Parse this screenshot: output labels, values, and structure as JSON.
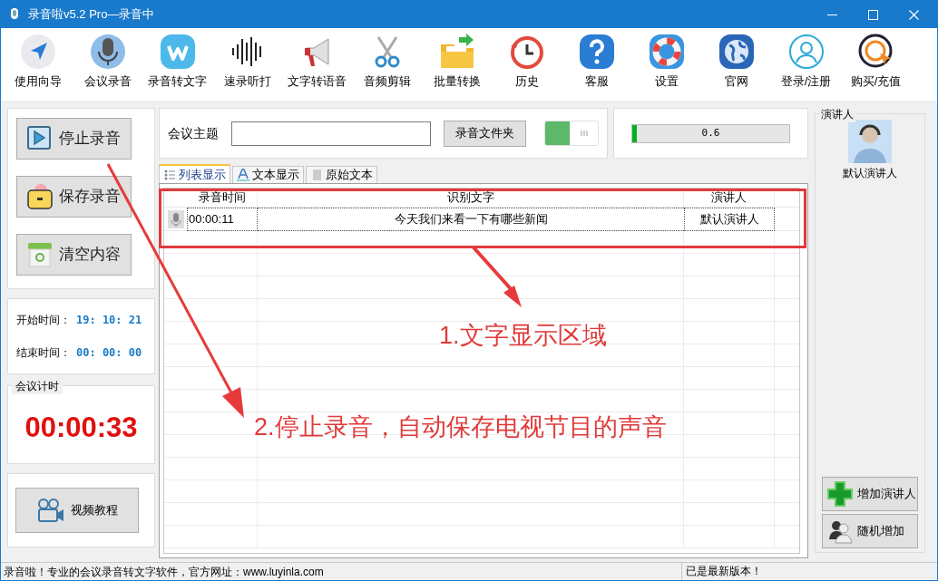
{
  "window": {
    "title": "录音啦v5.2 Pro—录音中"
  },
  "toolbar": [
    {
      "label": "使用向导"
    },
    {
      "label": "会议录音"
    },
    {
      "label": "录音转文字"
    },
    {
      "label": "速录听打"
    },
    {
      "label": "文字转语音"
    },
    {
      "label": "音频剪辑"
    },
    {
      "label": "批量转换"
    },
    {
      "label": "历史"
    },
    {
      "label": "客服"
    },
    {
      "label": "设置"
    },
    {
      "label": "官网"
    },
    {
      "label": "登录/注册"
    },
    {
      "label": "购买/充值"
    }
  ],
  "left_buttons": [
    {
      "label": "停止录音"
    },
    {
      "label": "保存录音"
    },
    {
      "label": "清空内容"
    }
  ],
  "times": [
    {
      "label": "开始时间：",
      "value": "19: 10: 21"
    },
    {
      "label": "结束时间：",
      "value": "00: 00: 00"
    }
  ],
  "meeting_timer": {
    "title": "会议计时",
    "value": "00:00:33"
  },
  "tutorial_button": {
    "label": "视频教程"
  },
  "topic": {
    "label": "会议主题",
    "folder_button": "录音文件夹",
    "toggle_on": true
  },
  "volume": {
    "level": 0.03,
    "reading": "0.6"
  },
  "tabs": [
    {
      "label": "列表显示",
      "selected": true
    },
    {
      "label": "文本显示",
      "selected": false
    },
    {
      "label": "原始文本",
      "selected": false
    }
  ],
  "table": {
    "columns": [
      "录音时间",
      "识别文字",
      "演讲人"
    ],
    "rows": [
      {
        "time": "00:00:11",
        "text": "今天我们来看一下有哪些新闻",
        "speaker": "默认演讲人"
      }
    ]
  },
  "speakers": {
    "title": "演讲人",
    "items": [
      {
        "name": "默认演讲人"
      }
    ],
    "buttons": [
      "增加演讲人",
      "随机增加"
    ]
  },
  "annotations": [
    {
      "text": "1.文字显示区域"
    },
    {
      "text": "2.停止录音，自动保存电视节目的声音"
    }
  ],
  "status_bar": {
    "left": "录音啦！专业的会议录音转文字软件，官方网址：www.luyinla.com",
    "right": "已是最新版本！"
  }
}
